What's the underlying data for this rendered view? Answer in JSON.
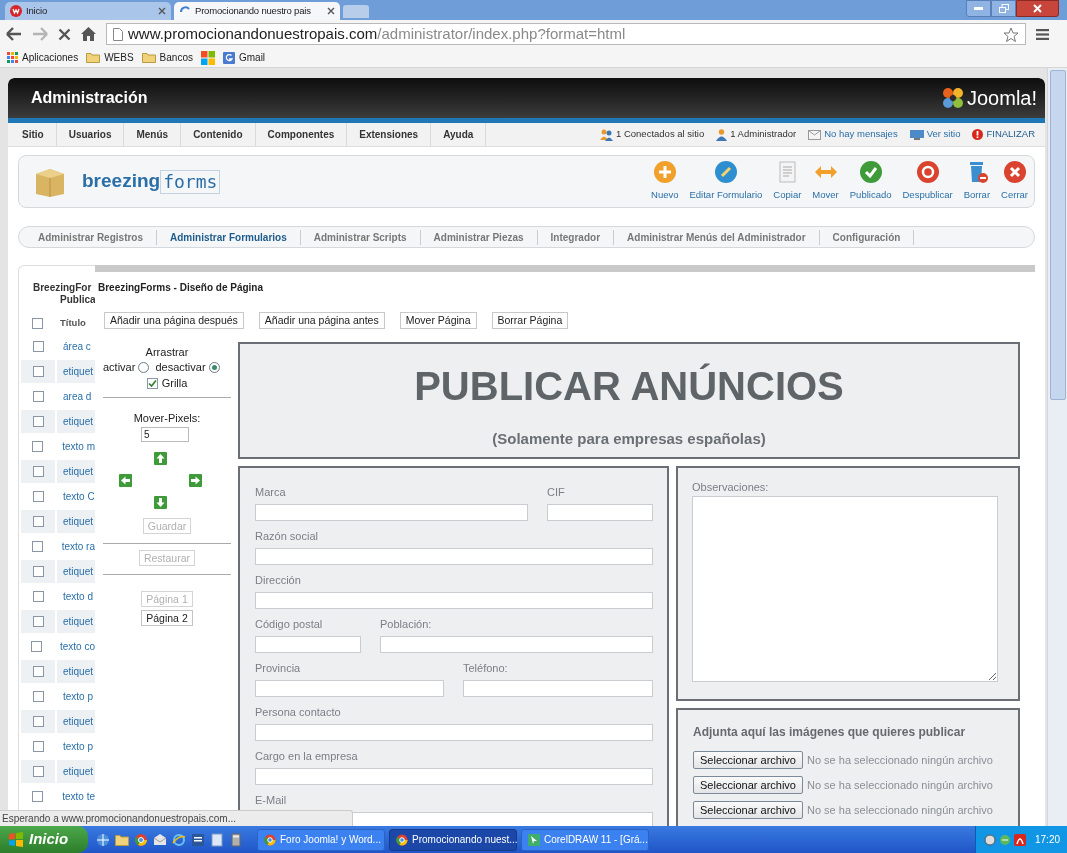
{
  "browser": {
    "tabs": [
      {
        "title": "Inicio",
        "kind": "site",
        "selected": false
      },
      {
        "title": "Promocionando nuestro pais",
        "kind": "loading",
        "selected": true
      }
    ],
    "url_host": "www.promocionandonuestropais.com",
    "url_path": "/administrator/index.php?format=html",
    "bookmarks": [
      {
        "kind": "apps",
        "label": "Aplicaciones"
      },
      {
        "kind": "folder",
        "label": "WEBS"
      },
      {
        "kind": "folder",
        "label": "Bancos"
      },
      {
        "kind": "tiles"
      },
      {
        "kind": "google",
        "label": "Gmail"
      }
    ],
    "status": "Esperando a www.promocionandonuestropais.com..."
  },
  "header": {
    "title": "Administración",
    "logo": "Joomla!"
  },
  "menu": [
    "Sitio",
    "Usuarios",
    "Menús",
    "Contenido",
    "Componentes",
    "Extensiones",
    "Ayuda"
  ],
  "status_links": [
    {
      "kind": "users",
      "text": "1 Conectados al sitio"
    },
    {
      "kind": "admin",
      "text": "1 Administrador"
    },
    {
      "kind": "messages",
      "text": "No hay mensajes"
    },
    {
      "kind": "site",
      "text": "Ver sitio"
    },
    {
      "kind": "logout",
      "text": "FINALIZAR"
    }
  ],
  "component": {
    "logo_bold": "breezing",
    "logo_light": "forms"
  },
  "toolbar": [
    {
      "kind": "new",
      "label": "Nuevo"
    },
    {
      "kind": "edit",
      "label": "Editar Formulario"
    },
    {
      "kind": "copy",
      "label": "Copiar"
    },
    {
      "kind": "move",
      "label": "Mover"
    },
    {
      "kind": "publish",
      "label": "Publicado"
    },
    {
      "kind": "unpublish",
      "label": "Despublicar"
    },
    {
      "kind": "delete",
      "label": "Borrar"
    },
    {
      "kind": "close",
      "label": "Cerrar"
    }
  ],
  "submenu": [
    {
      "label": "Administrar Registros",
      "selected": false
    },
    {
      "label": "Administrar Formularios",
      "selected": true
    },
    {
      "label": "Administrar Scripts",
      "selected": false
    },
    {
      "label": "Administrar Piezas",
      "selected": false
    },
    {
      "label": "Integrador",
      "selected": false
    },
    {
      "label": "Administrar Menús del Administrador",
      "selected": false
    },
    {
      "label": "Configuración",
      "selected": false
    }
  ],
  "list": {
    "heading": [
      "BreezingFor",
      "Publica"
    ],
    "select_all_checked": false,
    "column": "Título",
    "rows": [
      {
        "title": "área c",
        "checked": false
      },
      {
        "title": "etiquet",
        "checked": false
      },
      {
        "title": "area d",
        "checked": false
      },
      {
        "title": "etiquet",
        "checked": false
      },
      {
        "title": "texto m",
        "checked": false
      },
      {
        "title": "etiquet",
        "checked": false
      },
      {
        "title": "texto C",
        "checked": false
      },
      {
        "title": "etiquet",
        "checked": false
      },
      {
        "title": "texto ra",
        "checked": false
      },
      {
        "title": "etiquet",
        "checked": false
      },
      {
        "title": "texto d",
        "checked": false
      },
      {
        "title": "etiquet",
        "checked": false
      },
      {
        "title": "texto co",
        "checked": false
      },
      {
        "title": "etiquet",
        "checked": false
      },
      {
        "title": "texto p",
        "checked": false
      },
      {
        "title": "etiquet",
        "checked": false
      },
      {
        "title": "texto p",
        "checked": false
      },
      {
        "title": "etiquet",
        "checked": false
      },
      {
        "title": "texto te",
        "checked": false
      }
    ]
  },
  "designer": {
    "title": "BreezingForms - Diseño de Página",
    "page_buttons": [
      "Añadir una página después",
      "Añadir una página antes",
      "Mover Página",
      "Borrar Página"
    ],
    "drag_label": "Arrastrar",
    "drag_options": [
      {
        "label": "activar",
        "selected": false
      },
      {
        "label": "desactivar",
        "selected": true
      }
    ],
    "grid": {
      "label": "Grilla",
      "checked": true
    },
    "move_label": "Mover-Pixels:",
    "move_value": "5",
    "save": {
      "label": "Guardar",
      "disabled": true
    },
    "restore": {
      "label": "Restaurar",
      "disabled": true
    },
    "pages": [
      {
        "label": "Página 1",
        "disabled": true
      },
      {
        "label": "Página 2",
        "disabled": false
      }
    ],
    "canvas": {
      "title": "PUBLICAR ANÚNCIOS",
      "subtitle": "(Solamente para empresas españolas)",
      "field_rows": [
        [
          {
            "label": "Marca"
          },
          {
            "label": "CIF"
          }
        ],
        [
          {
            "label": "Razón social"
          }
        ],
        [
          {
            "label": "Dirección"
          }
        ],
        [
          {
            "label": "Código postal"
          },
          {
            "label": "Población:"
          }
        ],
        [
          {
            "label": "Provincia"
          },
          {
            "label": "Teléfono:"
          }
        ],
        [
          {
            "label": "Persona contacto"
          }
        ],
        [
          {
            "label": "Cargo en la empresa"
          }
        ],
        [
          {
            "label": "E-Mail"
          }
        ]
      ],
      "notes_label": "Observaciones:",
      "upload_heading": "Adjunta aquí las imágenes que quieres publicar",
      "uploads": [
        {
          "button": "Seleccionar archivo",
          "status": "No se ha seleccionado ningún archivo"
        },
        {
          "button": "Seleccionar archivo",
          "status": "No se ha seleccionado ningún archivo"
        },
        {
          "button": "Seleccionar archivo",
          "status": "No se ha seleccionado ningún archivo"
        }
      ]
    }
  },
  "taskbar": {
    "start": "Inicio",
    "tasks": [
      {
        "kind": "chrome",
        "label": "Foro Joomla! y Word...",
        "selected": false
      },
      {
        "kind": "chrome",
        "label": "Promocionando nuest...",
        "selected": true
      },
      {
        "kind": "corel",
        "label": "CorelDRAW 11 - [Grá...",
        "selected": false
      }
    ],
    "clock": "17:20"
  }
}
